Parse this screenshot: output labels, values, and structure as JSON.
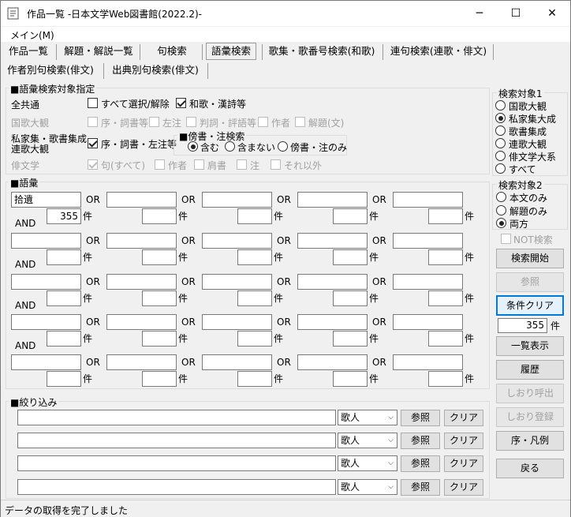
{
  "window": {
    "title": "作品一覧 -日本文学Web図書館(2022.2)-",
    "minimize": "─",
    "maximize": "☐",
    "close": "✕"
  },
  "menu": {
    "main": "メイン(M)"
  },
  "tabs": [
    "作品一覧",
    "解題・解説一覧",
    "句検索",
    "語彙検索",
    "歌集・歌番号検索(和歌)",
    "連句検索(連歌・俳文)",
    "作者別句検索(俳文)",
    "出典別句検索(俳文)"
  ],
  "target_spec": {
    "title": "■語彙検索対象指定",
    "all_label": "全共通",
    "select_all": "すべて選択/解除",
    "waka": "和歌・漢詩等",
    "kokka_label": "国歌大観",
    "kokka_opts": [
      "序・詞書等",
      "左注",
      "判詞・評語等",
      "作者",
      "解題(文)"
    ],
    "shika_label1": "私家集・歌書集成",
    "shika_label2": "連歌大観",
    "shika_opt": "序・詞書・左注等",
    "bousho": {
      "title": "■傍書・注検索",
      "opts": [
        "含む",
        "含まない",
        "傍書・注のみ"
      ]
    },
    "haibun_label": "俳文学",
    "haibun_opts": [
      "句(すべて)",
      "作者",
      "肩書",
      "注",
      "それ以外"
    ]
  },
  "vocab": {
    "title": "■語彙",
    "or": "OR",
    "and": "AND",
    "ken": "件",
    "first_term": "拾遺",
    "first_count": "355"
  },
  "filter": {
    "title": "■絞り込み",
    "select_value": "歌人",
    "ref_btn": "参照",
    "clear_btn": "クリア"
  },
  "side": {
    "target1": {
      "title": "検索対象1",
      "opts": [
        "国歌大観",
        "私家集大成",
        "歌書集成",
        "連歌大観",
        "俳文学大系",
        "すべて"
      ],
      "selected": 1
    },
    "target2": {
      "title": "検索対象2",
      "opts": [
        "本文のみ",
        "解題のみ",
        "両方"
      ],
      "selected": 2
    },
    "not_search": "NOT検索",
    "search_start": "検索開始",
    "ref": "参照",
    "clear_cond": "条件クリア",
    "count": "355",
    "ken": "件",
    "list_view": "一覧表示",
    "history": "履歴",
    "bm_call": "しおり呼出",
    "bm_reg": "しおり登録",
    "preface": "序・凡例",
    "back": "戻る"
  },
  "status": "データの取得を完了しました"
}
